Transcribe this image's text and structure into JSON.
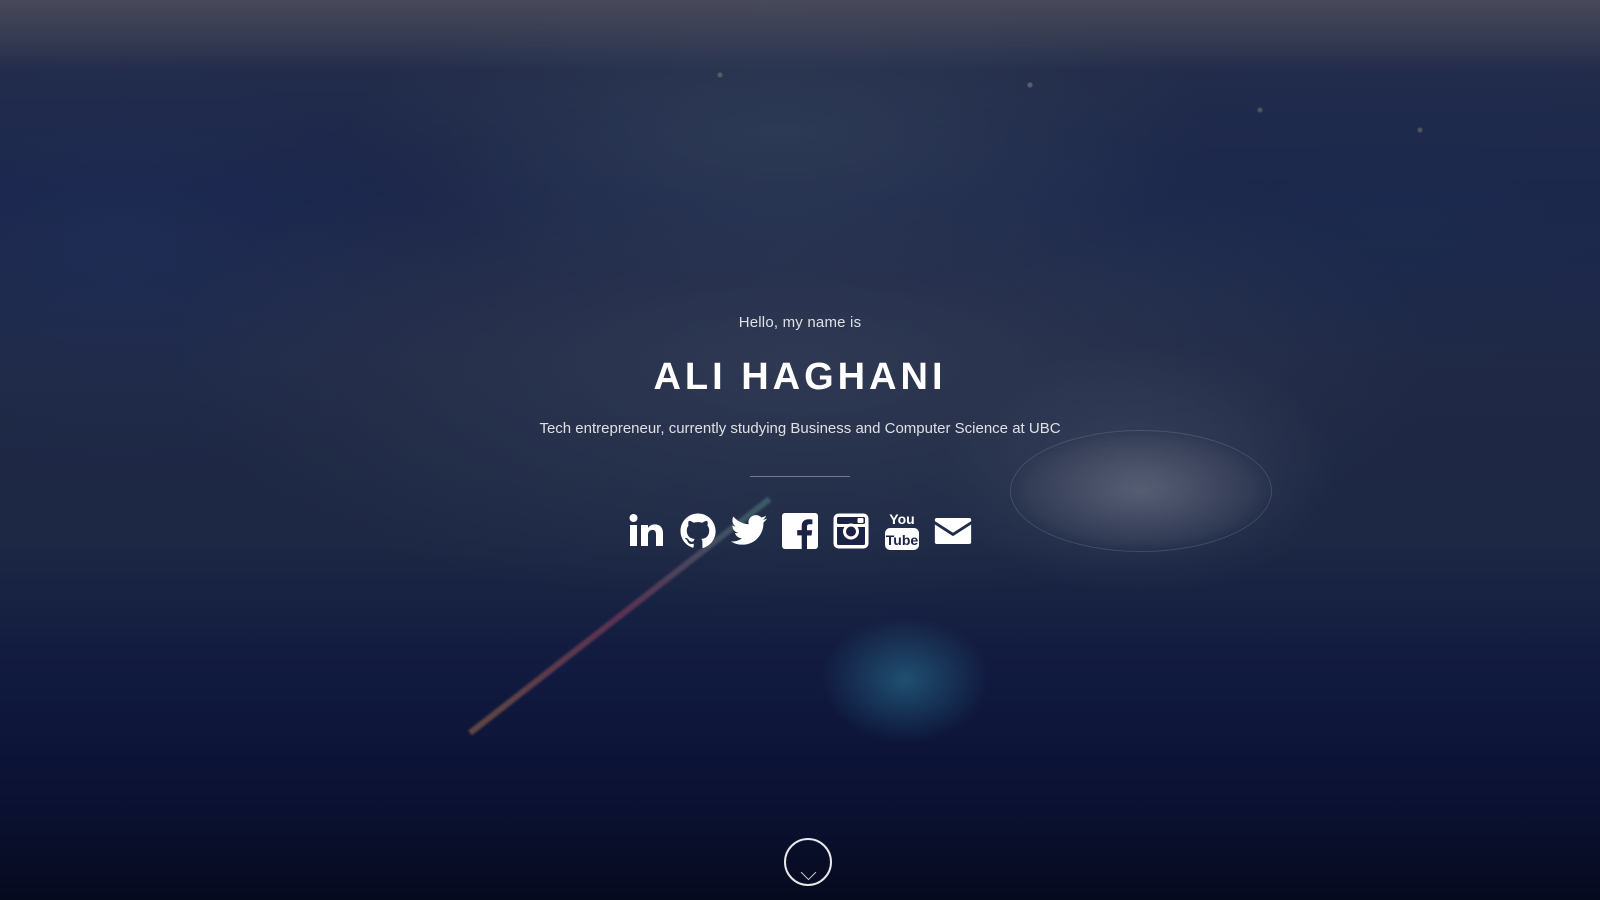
{
  "hero": {
    "background": "city-aerial-photo",
    "greeting": "Hello, my name is",
    "name": "ALI HAGHANI",
    "tagline": "Tech entrepreneur, currently studying Business and Computer Science at UBC"
  },
  "social": {
    "icons": [
      "linkedin-icon",
      "github-icon",
      "twitter-icon",
      "facebook-icon",
      "instagram-icon",
      "youtube-icon",
      "email-icon"
    ],
    "color": "#ffffff"
  },
  "scroll": {
    "icon": "chevron-down-icon"
  },
  "colors": {
    "text": "#ffffff",
    "overlay": "#0a0e28"
  }
}
